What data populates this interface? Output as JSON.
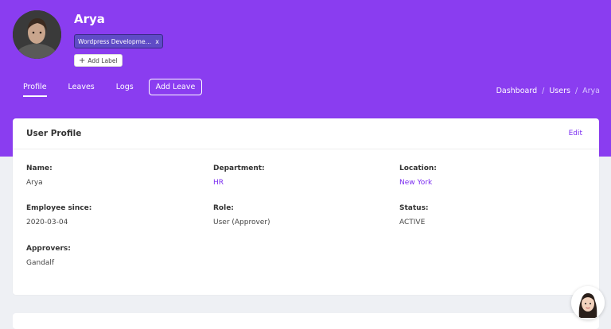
{
  "profile": {
    "name": "Arya",
    "tag": "Wordpress Developmen...",
    "tag_close": "x",
    "add_label": "Add Label"
  },
  "tabs": [
    {
      "label": "Profile",
      "active": true
    },
    {
      "label": "Leaves",
      "active": false
    },
    {
      "label": "Logs",
      "active": false
    }
  ],
  "add_leave_label": "Add Leave",
  "breadcrumb": {
    "items": [
      "Dashboard",
      "Users",
      "Arya"
    ],
    "separator": "/"
  },
  "card": {
    "title": "User Profile",
    "edit_label": "Edit",
    "fields": [
      {
        "label": "Name:",
        "value": "Arya"
      },
      {
        "label": "Department:",
        "value": "HR"
      },
      {
        "label": "Location:",
        "value": "New York"
      },
      {
        "label": "Employee since:",
        "value": "2020-03-04"
      },
      {
        "label": "Role:",
        "value": "User (Approver)"
      },
      {
        "label": "Status:",
        "value": "ACTIVE"
      },
      {
        "label": "Approvers:",
        "value": "Gandalf"
      }
    ]
  },
  "colors": {
    "header_bg": "#8a3df0",
    "accent": "#7b2df0",
    "tag_bg": "#5f4bc6"
  },
  "icons": {
    "avatar": "user-avatar-photo",
    "add_label": "plus-icon",
    "tag_close": "close-icon",
    "chat": "support-chat-avatar"
  }
}
